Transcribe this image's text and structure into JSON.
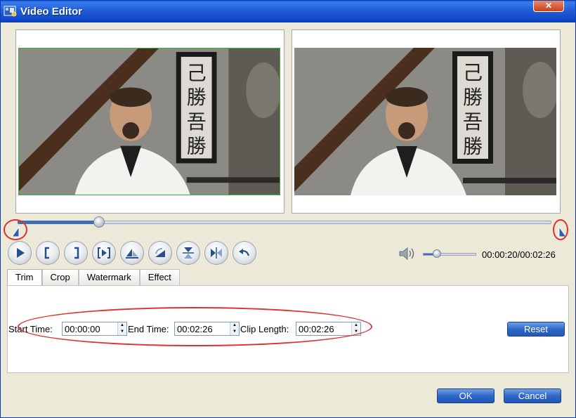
{
  "window": {
    "title": "Video Editor",
    "close_label": "✕"
  },
  "seek": {
    "position_fraction": 0.153
  },
  "volume": {
    "level_fraction": 0.25
  },
  "time": {
    "display": "00:00:20/00:02:26"
  },
  "controls": [
    {
      "name": "play-button",
      "icon": "play-icon"
    },
    {
      "name": "set-start-button",
      "icon": "left-bracket-icon"
    },
    {
      "name": "set-end-button",
      "icon": "right-bracket-icon"
    },
    {
      "name": "go-to-end-button",
      "icon": "jump-icon"
    },
    {
      "name": "flip-vertical-button",
      "icon": "flip-vertical-icon"
    },
    {
      "name": "rotate-button",
      "icon": "rotate-icon"
    },
    {
      "name": "flip-up-down-button",
      "icon": "flip-up-down-icon"
    },
    {
      "name": "flip-horizontal-button",
      "icon": "flip-horizontal-icon"
    },
    {
      "name": "undo-button",
      "icon": "undo-icon"
    }
  ],
  "tabs": [
    {
      "label": "Trim",
      "active": true
    },
    {
      "label": "Crop",
      "active": false
    },
    {
      "label": "Watermark",
      "active": false
    },
    {
      "label": "Effect",
      "active": false
    }
  ],
  "trim": {
    "start_label": "Start Time:",
    "start_value": "00:00:00",
    "end_label": "End Time:",
    "end_value": "00:02:26",
    "length_label": "Clip Length:",
    "length_value": "00:02:26",
    "reset_label": "Reset"
  },
  "footer": {
    "ok_label": "OK",
    "cancel_label": "Cancel"
  },
  "colors": {
    "accent": "#2f68c8",
    "highlight": "#e03030"
  }
}
